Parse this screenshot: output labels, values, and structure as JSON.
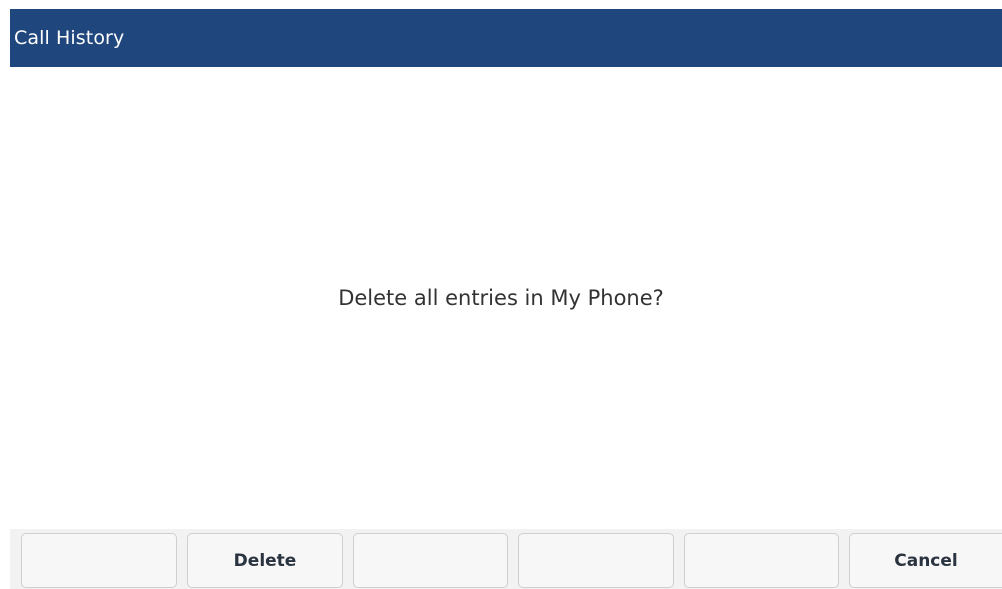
{
  "header": {
    "title": "Call History",
    "background_color": "#1f477d"
  },
  "dialog": {
    "message": "Delete all entries in My Phone?"
  },
  "softkeys": [
    {
      "label": ""
    },
    {
      "label": "Delete"
    },
    {
      "label": ""
    },
    {
      "label": ""
    },
    {
      "label": ""
    },
    {
      "label": "Cancel"
    }
  ]
}
